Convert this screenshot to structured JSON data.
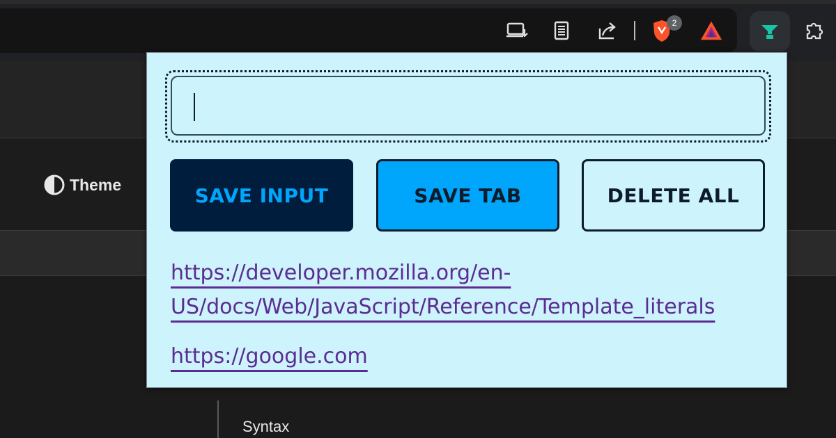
{
  "toolbar": {
    "icons": [
      "install-app-icon",
      "reader-mode-icon",
      "share-icon",
      "brave-shields-icon",
      "brave-rewards-icon",
      "leads-tracker-extension-icon",
      "extensions-puzzle-icon"
    ],
    "shields_badge": "2"
  },
  "page": {
    "theme_label": "Theme",
    "syntax_heading": "Syntax"
  },
  "popup": {
    "input": {
      "value": "",
      "placeholder": ""
    },
    "buttons": {
      "save_input": "SAVE INPUT",
      "save_tab": "SAVE TAB",
      "delete_all": "DELETE ALL"
    },
    "links": [
      {
        "text": "https://developer.mozilla.org/en-US/docs/Web/JavaScript/Reference/Template_literals",
        "href": "https://developer.mozilla.org/en-US/docs/Web/JavaScript/Reference/Template_literals"
      },
      {
        "text": "https://google.com",
        "href": "https://google.com"
      }
    ]
  },
  "colors": {
    "popup_bg": "#cdf3fd",
    "dark_navy": "#001d3d",
    "accent_blue": "#00a6fb",
    "link_purple": "#5b2c91",
    "brave_orange": "#fb542b"
  }
}
